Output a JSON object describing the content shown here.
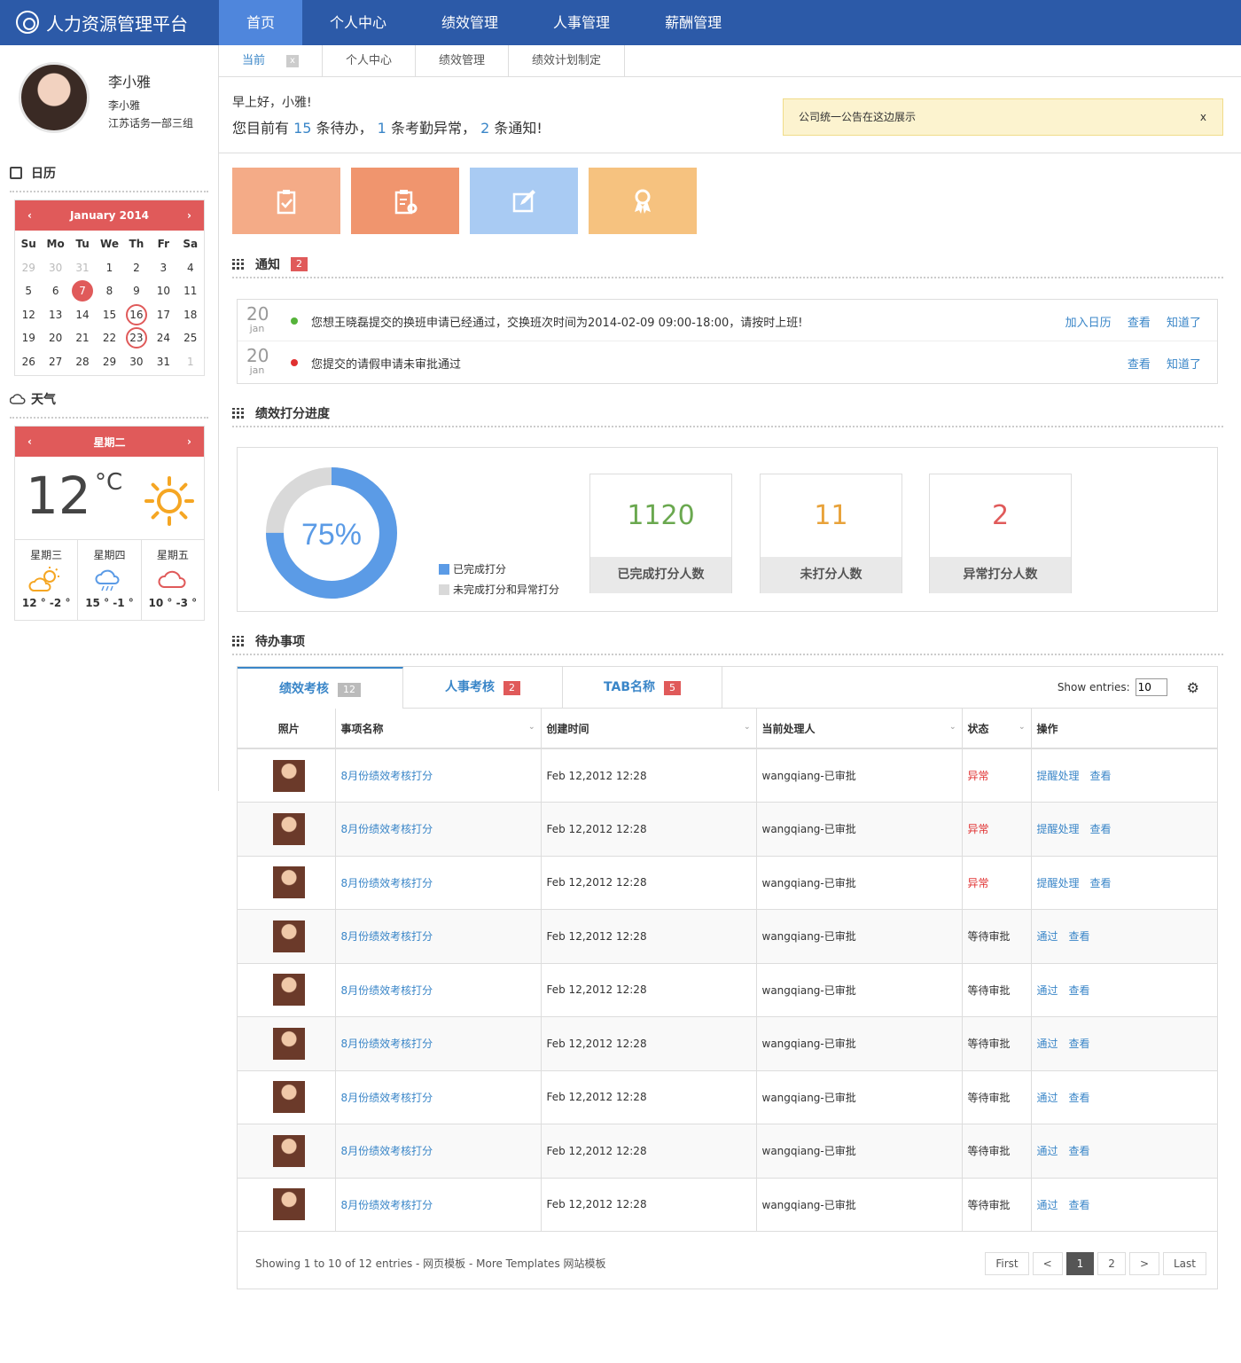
{
  "app": {
    "title": "人力资源管理平台"
  },
  "nav": [
    "首页",
    "个人中心",
    "绩效管理",
    "人事管理",
    "薪酬管理"
  ],
  "subtabs": {
    "current": "当前",
    "close": "x",
    "items": [
      "个人中心",
      "绩效管理",
      "绩效计划制定"
    ]
  },
  "profile": {
    "name": "李小雅",
    "sub": "李小雅",
    "dept": "江苏话务一部三组"
  },
  "calendar": {
    "section": "日历",
    "month": "January 2014",
    "prev": "‹",
    "next": "›",
    "dow": [
      "Su",
      "Mo",
      "Tu",
      "We",
      "Th",
      "Fr",
      "Sa"
    ],
    "days": [
      "29",
      "30",
      "31",
      "1",
      "2",
      "3",
      "4",
      "5",
      "6",
      "7",
      "8",
      "9",
      "10",
      "11",
      "12",
      "13",
      "14",
      "15",
      "16",
      "17",
      "18",
      "19",
      "20",
      "21",
      "22",
      "23",
      "24",
      "25",
      "26",
      "27",
      "28",
      "29",
      "30",
      "31",
      "1"
    ],
    "today": "7",
    "marked": [
      "16",
      "23"
    ]
  },
  "weather": {
    "section": "天气",
    "day": "星期二",
    "prev": "‹",
    "next": "›",
    "temp": "12",
    "unit": "°C",
    "forecast": [
      {
        "day": "星期三",
        "icon": "partly-sunny-icon",
        "temp": "12 ° -2 °"
      },
      {
        "day": "星期四",
        "icon": "rain-icon",
        "temp": "15 ° -1 °"
      },
      {
        "day": "星期五",
        "icon": "cloud-icon",
        "temp": "10 ° -3 °"
      }
    ]
  },
  "greeting": {
    "hello": "早上好，小雅!",
    "p1": "您目前有",
    "n1": "15",
    "p2": "条待办，",
    "n2": "1",
    "p3": "条考勤异常，",
    "n3": "2",
    "p4": "条通知!"
  },
  "announcement": {
    "text": "公司统一公告在这边展示",
    "close": "x"
  },
  "tiles": [
    {
      "icon": "clipboard-check-icon",
      "color": "#f4ab87"
    },
    {
      "icon": "clipboard-gear-icon",
      "color": "#f0956e"
    },
    {
      "icon": "edit-icon",
      "color": "#a9cbf3"
    },
    {
      "icon": "award-icon",
      "color": "#f6c27f"
    }
  ],
  "notifications": {
    "title": "通知",
    "count": "2",
    "items": [
      {
        "day": "20",
        "month": "jan",
        "dot": "#55b33a",
        "text": "您想王晓磊提交的换班申请已经通过，交换班次时间为2014-02-09 09:00-18:00，请按时上班!",
        "actions": [
          "加入日历",
          "查看",
          "知道了"
        ]
      },
      {
        "day": "20",
        "month": "jan",
        "dot": "#e03030",
        "text": "您提交的请假申请未审批通过",
        "actions": [
          "查看",
          "知道了"
        ]
      }
    ]
  },
  "performance": {
    "title": "绩效打分进度",
    "percent": "75%",
    "progress": 0.75,
    "legend": [
      "已完成打分",
      "未完成打分和异常打分"
    ],
    "colors": {
      "done": "#5b9be6",
      "rest": "#d9d9d9"
    },
    "stats": [
      {
        "value": "1120",
        "label": "已完成打分人数",
        "color": "#6aa84f"
      },
      {
        "value": "11",
        "label": "未打分人数",
        "color": "#e8a23a"
      },
      {
        "value": "2",
        "label": "异常打分人数",
        "color": "#e05a5a"
      }
    ]
  },
  "todo": {
    "title": "待办事项",
    "tabs": [
      {
        "label": "绩效考核",
        "count": "12"
      },
      {
        "label": "人事考核",
        "count": "2"
      },
      {
        "label": "TAB名称",
        "count": "5"
      }
    ],
    "show_label": "Show entries:",
    "show_value": "10",
    "columns": [
      "照片",
      "事项名称",
      "创建时间",
      "当前处理人",
      "状态",
      "操作"
    ],
    "rows": [
      {
        "name": "8月份绩效考核打分",
        "time": "Feb 12,2012 12:28",
        "handler": "wangqiang-已审批",
        "status": "异常",
        "actions": [
          "提醒处理",
          "查看"
        ]
      },
      {
        "name": "8月份绩效考核打分",
        "time": "Feb 12,2012 12:28",
        "handler": "wangqiang-已审批",
        "status": "异常",
        "actions": [
          "提醒处理",
          "查看"
        ]
      },
      {
        "name": "8月份绩效考核打分",
        "time": "Feb 12,2012 12:28",
        "handler": "wangqiang-已审批",
        "status": "异常",
        "actions": [
          "提醒处理",
          "查看"
        ]
      },
      {
        "name": "8月份绩效考核打分",
        "time": "Feb 12,2012 12:28",
        "handler": "wangqiang-已审批",
        "status": "等待审批",
        "actions": [
          "通过",
          "查看"
        ]
      },
      {
        "name": "8月份绩效考核打分",
        "time": "Feb 12,2012 12:28",
        "handler": "wangqiang-已审批",
        "status": "等待审批",
        "actions": [
          "通过",
          "查看"
        ]
      },
      {
        "name": "8月份绩效考核打分",
        "time": "Feb 12,2012 12:28",
        "handler": "wangqiang-已审批",
        "status": "等待审批",
        "actions": [
          "通过",
          "查看"
        ]
      },
      {
        "name": "8月份绩效考核打分",
        "time": "Feb 12,2012 12:28",
        "handler": "wangqiang-已审批",
        "status": "等待审批",
        "actions": [
          "通过",
          "查看"
        ]
      },
      {
        "name": "8月份绩效考核打分",
        "time": "Feb 12,2012 12:28",
        "handler": "wangqiang-已审批",
        "status": "等待审批",
        "actions": [
          "通过",
          "查看"
        ]
      },
      {
        "name": "8月份绩效考核打分",
        "time": "Feb 12,2012 12:28",
        "handler": "wangqiang-已审批",
        "status": "等待审批",
        "actions": [
          "通过",
          "查看"
        ]
      }
    ],
    "info": "Showing 1 to 10 of 12 entries - 网页模板 - More Templates 网站模板",
    "pager": [
      "First",
      "<",
      "1",
      "2",
      ">",
      "Last"
    ],
    "current_page": "1"
  }
}
